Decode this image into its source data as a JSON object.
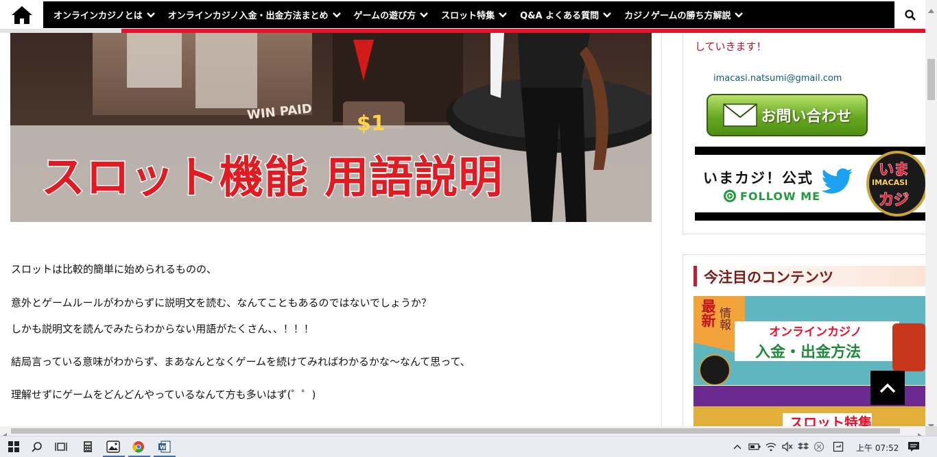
{
  "nav": {
    "items": [
      {
        "label": "オンラインカジノとは"
      },
      {
        "label": "オンラインカジノ入金・出金方法まとめ"
      },
      {
        "label": "ゲームの遊び方"
      },
      {
        "label": "スロット特集"
      },
      {
        "label": "Q&A よくある質問"
      },
      {
        "label": "カジノゲームの勝ち方解説"
      }
    ]
  },
  "banner": {
    "title": "スロット機能 用語説明",
    "win_paid": "WIN PAID",
    "coin": "$1"
  },
  "article": {
    "paragraphs": [
      "スロットは比較的簡単に始められるものの、",
      "意外とゲームルールがわからずに説明文を読む、なんてこともあるのではないでしょうか？",
      "しかも説明文を読んでみたらわからない用語がたくさん、、！！！",
      "結局言っている意味がわからず、まあなんとなくゲームを続けてみればわかるかな〜なんて思って、",
      "理解せずにゲームをどんどんやっているなんて方も多いはず(゜゜)"
    ]
  },
  "sidebar": {
    "intro_tail": "していきます！",
    "email": "imacasi.natsumi@gmail.com",
    "contact_label": "お問い合わせ",
    "twitter": {
      "title": "いまカジ！公式",
      "follow": "FOLLOW ME",
      "logo_top": "いま",
      "logo_mid": "IMACASI",
      "logo_bottom": "カジ"
    },
    "section_title": "今注目のコンテンツ",
    "promo1": {
      "badge_1": "最新",
      "badge_2": "情報",
      "line1": "オンラインカジノ",
      "line2": "入金・出金方法"
    },
    "promo2": {
      "text": "スロット特集"
    }
  },
  "taskbar": {
    "time": "上午 07:52"
  },
  "colors": {
    "accent_red": "#e8102a",
    "nav_bg": "#000000",
    "contact_green": "#67a821",
    "twitter_blue": "#1da1f2"
  }
}
